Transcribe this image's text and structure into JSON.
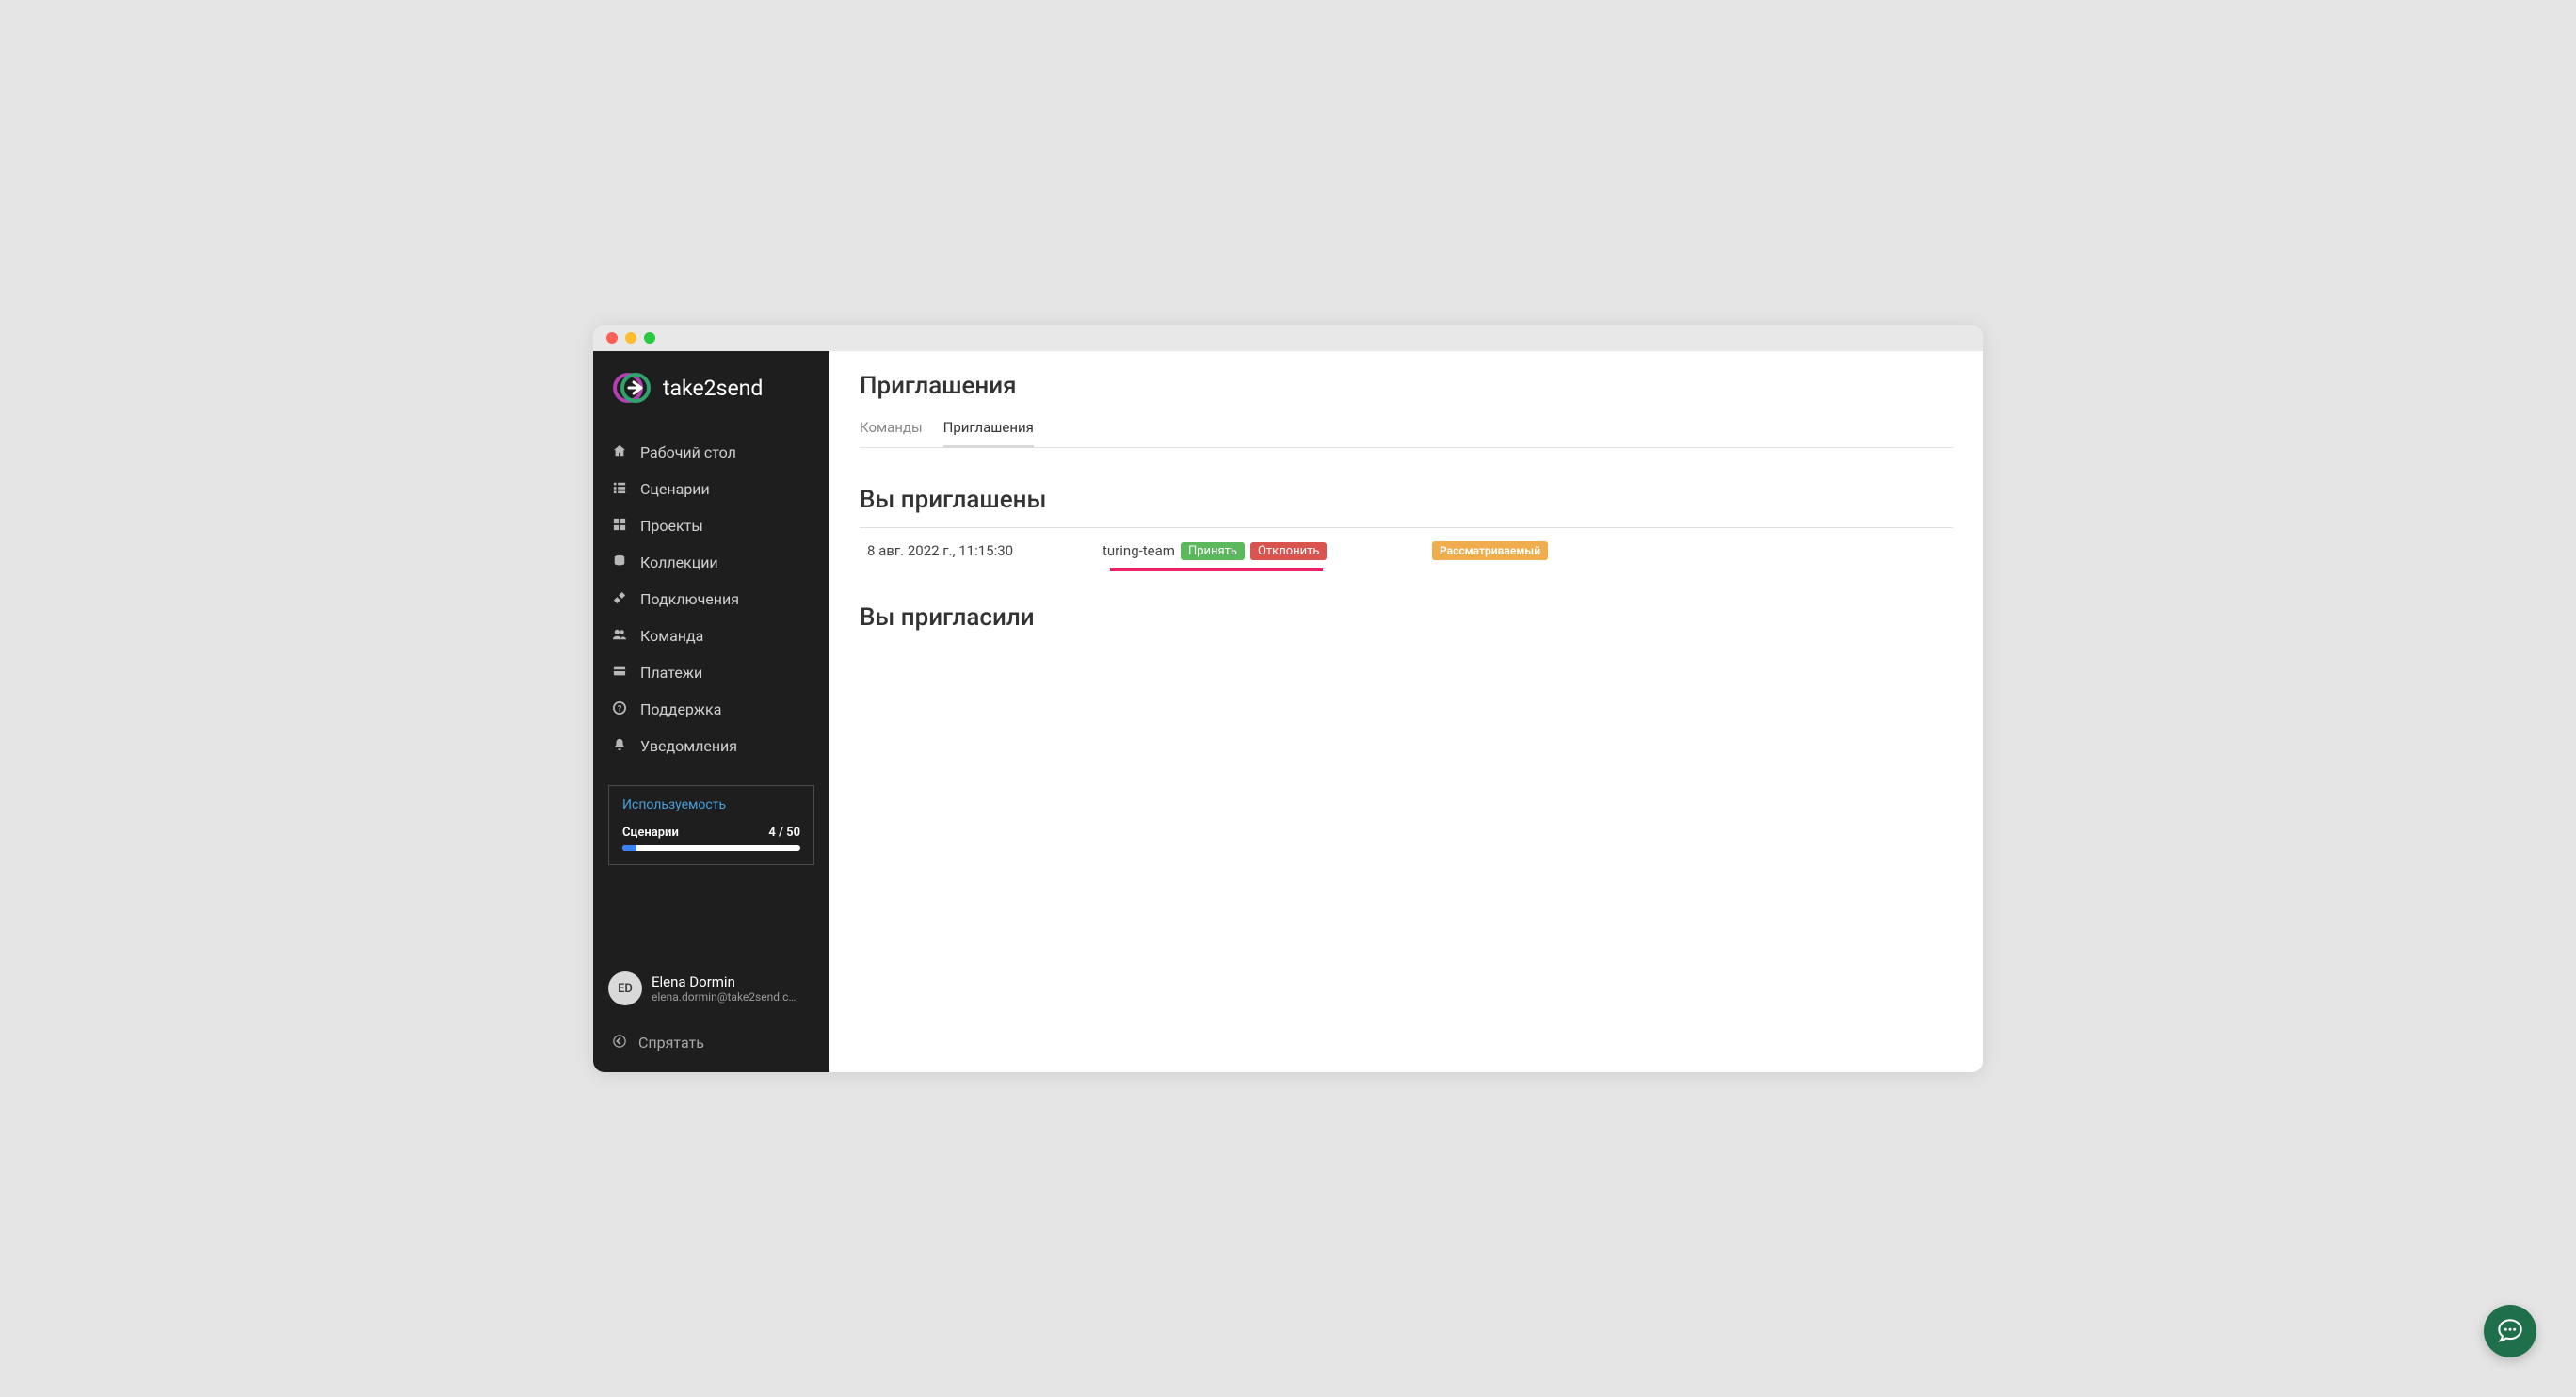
{
  "brand": {
    "name": "take2send"
  },
  "sidebar": {
    "items": [
      {
        "icon": "home",
        "label": "Рабочий стол"
      },
      {
        "icon": "list",
        "label": "Сценарии"
      },
      {
        "icon": "grid",
        "label": "Проекты"
      },
      {
        "icon": "database",
        "label": "Коллекции"
      },
      {
        "icon": "plug",
        "label": "Подключения"
      },
      {
        "icon": "users",
        "label": "Команда"
      },
      {
        "icon": "card",
        "label": "Платежи"
      },
      {
        "icon": "help",
        "label": "Поддержка"
      },
      {
        "icon": "bell",
        "label": "Уведомления"
      }
    ],
    "usage": {
      "title": "Используемость",
      "label": "Сценарии",
      "value": "4 / 50"
    },
    "profile": {
      "initials": "ED",
      "name": "Elena Dormin",
      "email": "elena.dormin@take2send.c…"
    },
    "collapse": "Спрятать"
  },
  "page": {
    "title": "Приглашения",
    "tabs": [
      {
        "label": "Команды",
        "active": false
      },
      {
        "label": "Приглашения",
        "active": true
      }
    ],
    "sections": {
      "invited_to": "Вы приглашены",
      "invited_by_you": "Вы пригласили"
    },
    "invitations": [
      {
        "date": "8 авг. 2022 г., 11:15:30",
        "team": "turing-team",
        "accept": "Принять",
        "decline": "Отклонить",
        "status": "Рассматриваемый"
      }
    ]
  }
}
